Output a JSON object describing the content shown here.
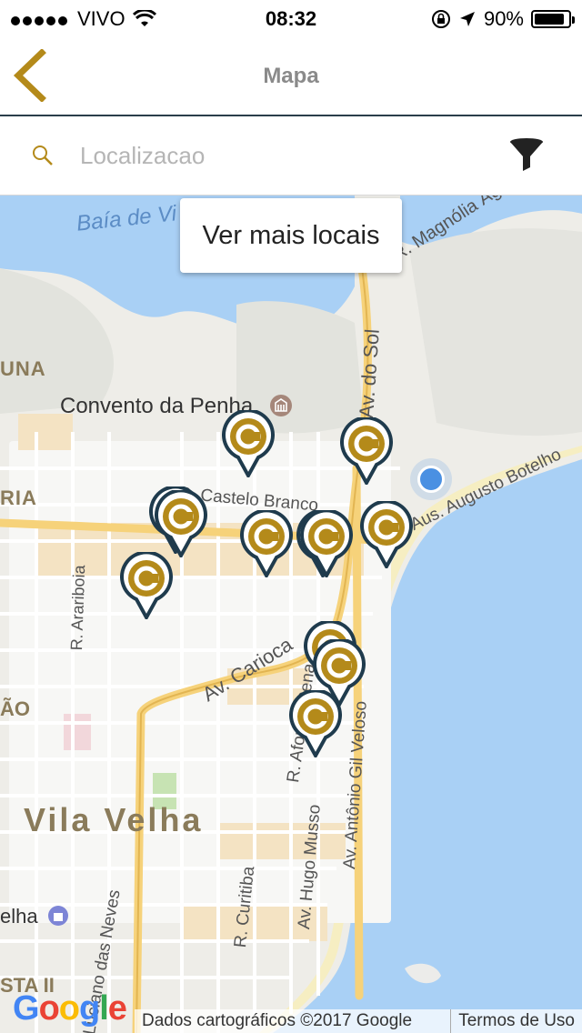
{
  "status_bar": {
    "carrier": "VIVO",
    "time": "08:32",
    "battery": "90%",
    "battery_level": 0.9
  },
  "nav": {
    "title": "Mapa"
  },
  "search": {
    "placeholder": "Localizacao"
  },
  "map": {
    "popup_button": "Ver mais locais",
    "labels": {
      "bay": "Baía de Vi",
      "magnolia": "R. Magnólia Águiar",
      "una": "UNA",
      "convento": "Convento da Penha",
      "do_sol": "Av. do Sol",
      "ria": "RIA",
      "castelo": "R. Castelo Branco",
      "botelho": "Aus. Augusto Botelho",
      "araribo": "R. Arariboia",
      "carioca": "Av. Carioca",
      "afonso": "R. Afonso Pena",
      "ao": "ÃO",
      "gil": "Av. Antônio Gil Veloso",
      "hugo": "Av. Hugo Musso",
      "vila_velha": "Vila Velha",
      "curitiba": "R. Curitiba",
      "neves": "Luciano das Neves",
      "elha": "elha",
      "sta": "STA II"
    },
    "google_logo": "Google",
    "attribution": "Dados cartográficos ©2017 Google",
    "terms": "Termos de Uso"
  },
  "colors": {
    "accent": "#b48a1a",
    "pin_ring": "#1f3b4d",
    "water": "#a9d0f5"
  }
}
